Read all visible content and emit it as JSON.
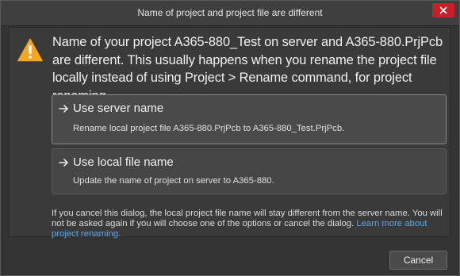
{
  "window": {
    "title": "Name of project and project file are different",
    "close_icon": "close-icon"
  },
  "message": {
    "icon": "warning-icon",
    "text": "Name of your project A365-880_Test on server and A365-880.PrjPcb are different. This usually happens when you rename the project file locally instead of using Project > Rename command, for project renaming."
  },
  "options": [
    {
      "icon": "arrow-right-icon",
      "title": "Use server name",
      "description": "Rename local project file A365-880.PrjPcb to A365-880_Test.PrjPcb."
    },
    {
      "icon": "arrow-right-icon",
      "title": "Use local file name",
      "description": "Update the name of project on server to A365-880."
    }
  ],
  "footnote": {
    "text": "If you cancel this dialog, the local project file name will stay different from the server name. You will not be asked again if you will choose one of the options or cancel the dialog.",
    "link": "Learn more about project renaming."
  },
  "buttons": {
    "cancel_label": "Cancel"
  },
  "colors": {
    "accent_close": "#c8202b",
    "warning": "#f5a623",
    "link": "#5aa6e6"
  }
}
